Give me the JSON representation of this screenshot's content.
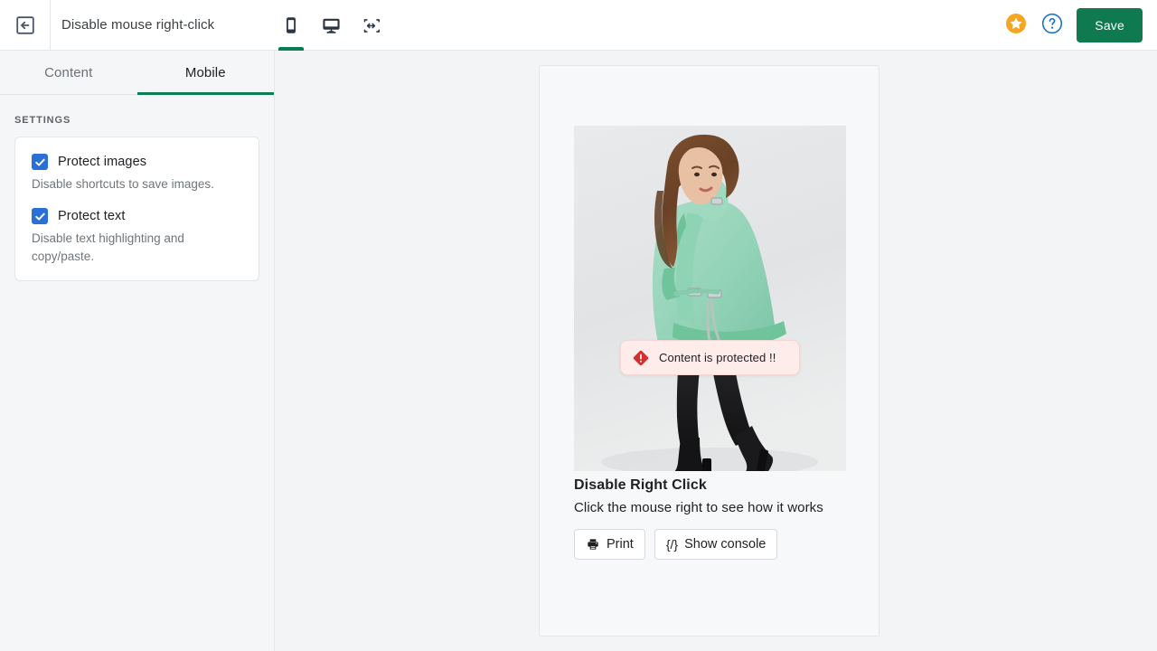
{
  "topbar": {
    "back_icon": "exit-left-arrow-icon",
    "title": "Disable mouse right-click",
    "devices": [
      {
        "name": "mobile",
        "icon": "mobile-phone-icon",
        "active": true
      },
      {
        "name": "desktop",
        "icon": "desktop-monitor-icon",
        "active": false
      },
      {
        "name": "responsive",
        "icon": "responsive-resize-icon",
        "active": false
      }
    ],
    "favorite_icon": "star-icon",
    "help_icon": "help-question-icon",
    "save_label": "Save",
    "save_color": "#0f7a50"
  },
  "sidebar": {
    "tabs": [
      {
        "label": "Content",
        "active": false
      },
      {
        "label": "Mobile",
        "active": true
      }
    ],
    "section_label": "SETTINGS",
    "settings": [
      {
        "label": "Protect images",
        "description": "Disable shortcuts to save images.",
        "checked": true
      },
      {
        "label": "Protect text",
        "description": "Disable text highlighting and copy/paste.",
        "checked": true
      }
    ],
    "checkbox_color": "#2a6fd6"
  },
  "preview": {
    "image_alt": "Woman wearing mint green shearling aviator jacket, black leggings and black heeled ankle boots",
    "toast": {
      "icon": "alert-diamond-icon",
      "text": "Content is protected !!",
      "background": "#fdecea",
      "icon_color": "#d32f2f"
    },
    "title": "Disable Right Click",
    "description": "Click the mouse right to see how it works",
    "buttons": [
      {
        "label": "Print",
        "icon": "printer-icon",
        "glyph": ""
      },
      {
        "label": "Show console",
        "icon": "code-braces-icon",
        "glyph": "{/}"
      }
    ]
  }
}
